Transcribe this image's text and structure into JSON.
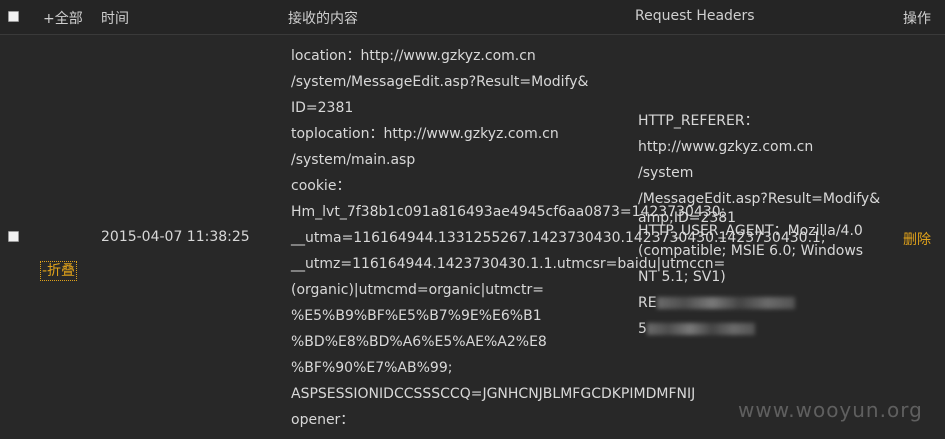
{
  "header": {
    "expand_all": "+全部",
    "time": "时间",
    "content": "接收的内容",
    "request_headers": "Request Headers",
    "action": "操作"
  },
  "row": {
    "toggle": "-折叠",
    "time": "2015-04-07 11:38:25",
    "content_lines": [
      "location：http://www.gzkyz.com.cn",
      "/system/MessageEdit.asp?Result=Modify&",
      "ID=2381",
      "toplocation：http://www.gzkyz.com.cn",
      "/system/main.asp",
      "cookie：",
      "Hm_lvt_7f38b1c091a816493ae4945cf6aa0873=1423730430;",
      "__utma=116164944.1331255267.1423730430.1423730430.1423730430.1;",
      "__utmz=116164944.1423730430.1.1.utmcsr=baidu|utmccn=",
      "(organic)|utmcmd=organic|utmctr=",
      "%E5%B9%BF%E5%B7%9E%E6%B1",
      "%BD%E8%BD%A6%E5%AE%A2%E8",
      "%BF%90%E7%AB%99;",
      "ASPSESSIONIDCCSSSCCQ=JGNHCNJBLMFGCDKPIMDMFNIJ",
      "opener："
    ],
    "header_lines": {
      "l1": "HTTP_REFERER：",
      "l2": "http://www.gzkyz.com.cn",
      "l3": "/system",
      "l4": "/MessageEdit.asp?Result=Modify&",
      "l5": "amp;ID=2381",
      "l6": "HTTP_USER_AGENT：Mozilla/4.0",
      "l7": "(compatible; MSIE 6.0; Windows",
      "l8": "NT 5.1; SV1)",
      "l9": "RE",
      "l10": "5"
    },
    "delete": "删除"
  },
  "watermark": "www.wooyun.org",
  "colors": {
    "background": "#282828",
    "accent": "#e0a21a",
    "text": "#d8d8d8"
  }
}
